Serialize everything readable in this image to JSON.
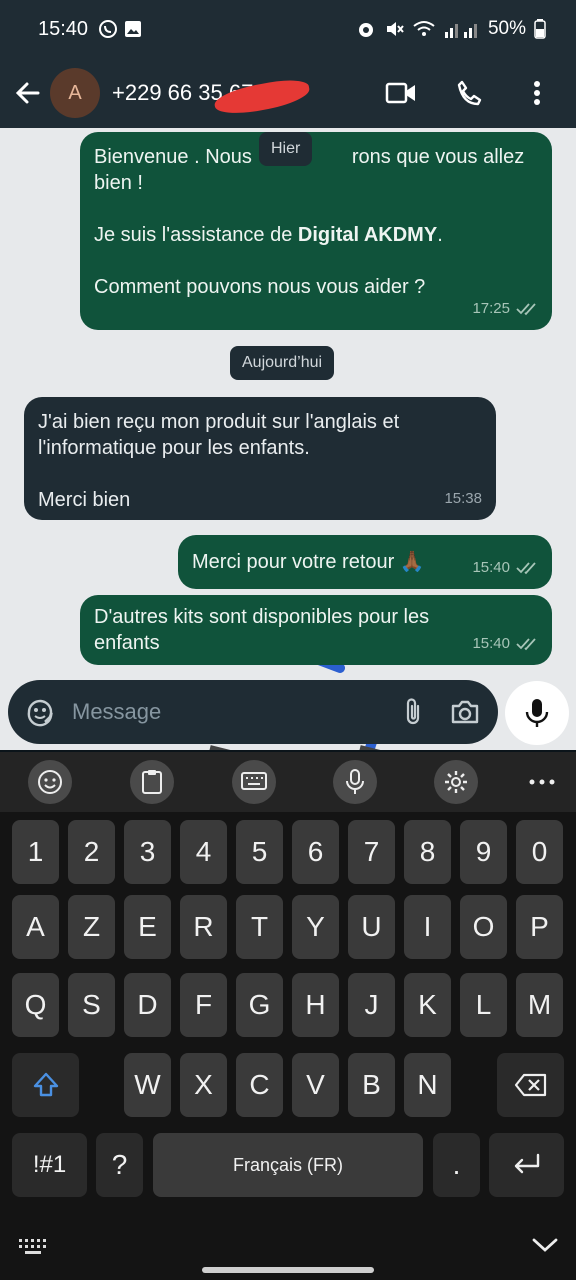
{
  "status_bar": {
    "time": "15:40",
    "battery": "50%"
  },
  "header": {
    "avatar_letter": "A",
    "contact": "+229 66 35 67 4"
  },
  "chat": {
    "messages": [
      {
        "direction": "out",
        "line1": "Bienvenue . Nous",
        "line1b": "rons que vous allez",
        "line2": "bien !",
        "line3_prefix": "Je suis l'assistance de ",
        "line3_bold": "Digital AKDMY",
        "line3_suffix": ".",
        "line4": "Comment pouvons nous vous aider ?",
        "time": "17:25"
      },
      {
        "direction": "in",
        "line1": "J'ai bien reçu mon produit sur l'anglais et",
        "line2": "l'informatique pour les enfants.",
        "line3": "Merci bien",
        "time": "15:38"
      },
      {
        "direction": "out",
        "text": "Merci pour votre retour 🙏🏾",
        "time": "15:40"
      },
      {
        "direction": "out",
        "line1": "D'autres kits sont disponibles pour les",
        "line2": "enfants",
        "time": "15:40"
      }
    ],
    "day_chips": [
      "Hier",
      "Aujourd’hui"
    ]
  },
  "composer": {
    "placeholder": "Message"
  },
  "keyboard": {
    "row_numbers": [
      "1",
      "2",
      "3",
      "4",
      "5",
      "6",
      "7",
      "8",
      "9",
      "0"
    ],
    "row1": [
      "A",
      "Z",
      "E",
      "R",
      "T",
      "Y",
      "U",
      "I",
      "O",
      "P"
    ],
    "row2": [
      "Q",
      "S",
      "D",
      "F",
      "G",
      "H",
      "J",
      "K",
      "L",
      "M"
    ],
    "row3": [
      "W",
      "X",
      "C",
      "V",
      "B",
      "N"
    ],
    "symbols": "!#1",
    "question": "?",
    "space": "Français (FR)",
    "period": "."
  },
  "colors": {
    "outgoing_bubble": "#10533b",
    "incoming_bubble": "#1f2c34",
    "chat_background": "#e7e9eb",
    "header": "#1f2c34"
  }
}
